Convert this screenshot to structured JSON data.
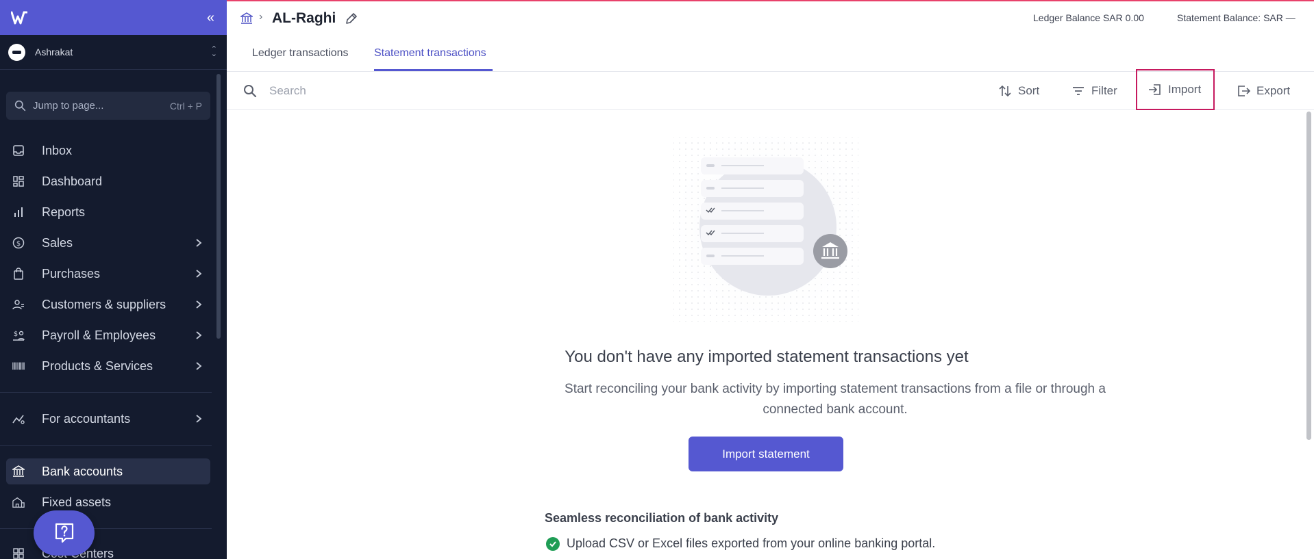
{
  "sidebar": {
    "org_name": "Ashrakat",
    "jump": {
      "label": "Jump to page...",
      "shortcut": "Ctrl + P"
    },
    "items": [
      {
        "label": "Inbox",
        "icon": "inbox-icon"
      },
      {
        "label": "Dashboard",
        "icon": "dashboard-icon"
      },
      {
        "label": "Reports",
        "icon": "reports-icon"
      },
      {
        "label": "Sales",
        "icon": "sales-icon",
        "has_children": true
      },
      {
        "label": "Purchases",
        "icon": "purchases-icon",
        "has_children": true
      },
      {
        "label": "Customers & suppliers",
        "icon": "customers-icon",
        "has_children": true
      },
      {
        "label": "Payroll & Employees",
        "icon": "payroll-icon",
        "has_children": true
      },
      {
        "label": "Products & Services",
        "icon": "barcode-icon",
        "has_children": true
      },
      {
        "label": "For accountants",
        "icon": "accountants-icon",
        "has_children": true
      },
      {
        "label": "Bank accounts",
        "icon": "bank-icon",
        "active": true
      },
      {
        "label": "Fixed assets",
        "icon": "building-icon"
      },
      {
        "label": "Cost Centers",
        "icon": "cost-centers-icon"
      }
    ]
  },
  "header": {
    "title": "AL-Raghi",
    "ledger_balance": "Ledger Balance SAR 0.00",
    "statement_balance": "Statement Balance: SAR —"
  },
  "tabs": [
    {
      "label": "Ledger transactions",
      "active": false
    },
    {
      "label": "Statement transactions",
      "active": true
    }
  ],
  "toolbar": {
    "search_placeholder": "Search",
    "sort_label": "Sort",
    "filter_label": "Filter",
    "import_label": "Import",
    "export_label": "Export"
  },
  "empty_state": {
    "title": "You don't have any imported statement transactions yet",
    "description": "Start reconciling your bank activity by importing statement transactions from a file or through a connected bank account.",
    "cta_label": "Import statement",
    "benefit_title": "Seamless reconciliation of bank activity",
    "benefits": [
      "Upload CSV or Excel files exported from your online banking portal."
    ]
  },
  "colors": {
    "brand": "#5558d1",
    "sidebar_bg": "#141b2e",
    "highlight_border": "#c6195e",
    "success": "#1f9d55"
  }
}
